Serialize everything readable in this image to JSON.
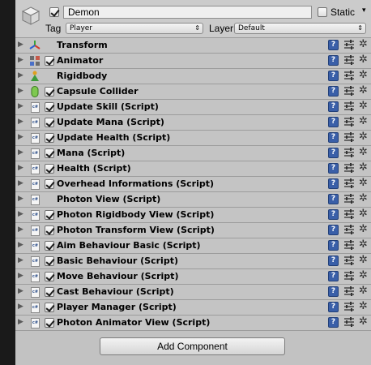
{
  "gameobject": {
    "name": "Demon",
    "static_label": "Static",
    "tag_label": "Tag",
    "tag_value": "Player",
    "layer_label": "Layer",
    "layer_value": "Default"
  },
  "components": [
    {
      "label": "Transform",
      "icon": "transform-icon",
      "checkbox": false
    },
    {
      "label": "Animator",
      "icon": "animator-icon",
      "checkbox": true
    },
    {
      "label": "Rigidbody",
      "icon": "rigidbody-icon",
      "checkbox": false
    },
    {
      "label": "Capsule Collider",
      "icon": "capsule-collider-icon",
      "checkbox": true
    },
    {
      "label": "Update Skill (Script)",
      "icon": "script-icon",
      "checkbox": true
    },
    {
      "label": "Update Mana (Script)",
      "icon": "script-icon",
      "checkbox": true
    },
    {
      "label": "Update Health (Script)",
      "icon": "script-icon",
      "checkbox": true
    },
    {
      "label": "Mana (Script)",
      "icon": "script-icon",
      "checkbox": true
    },
    {
      "label": "Health (Script)",
      "icon": "script-icon",
      "checkbox": true
    },
    {
      "label": "Overhead Informations (Script)",
      "icon": "script-icon",
      "checkbox": true
    },
    {
      "label": "Photon View (Script)",
      "icon": "script-icon",
      "checkbox": false
    },
    {
      "label": "Photon Rigidbody View (Script)",
      "icon": "script-icon",
      "checkbox": true
    },
    {
      "label": "Photon Transform View (Script)",
      "icon": "script-icon",
      "checkbox": true
    },
    {
      "label": "Aim Behaviour Basic (Script)",
      "icon": "script-icon",
      "checkbox": true
    },
    {
      "label": "Basic Behaviour (Script)",
      "icon": "script-icon",
      "checkbox": true
    },
    {
      "label": "Move Behaviour (Script)",
      "icon": "script-icon",
      "checkbox": true
    },
    {
      "label": "Cast Behaviour (Script)",
      "icon": "script-icon",
      "checkbox": true
    },
    {
      "label": "Player Manager (Script)",
      "icon": "script-icon",
      "checkbox": true
    },
    {
      "label": "Photon Animator View (Script)",
      "icon": "script-icon",
      "checkbox": true
    }
  ],
  "add_component_label": "Add Component",
  "colors": {
    "panel_bg": "#c2c2c2",
    "help_icon": "#3a5fa8"
  }
}
